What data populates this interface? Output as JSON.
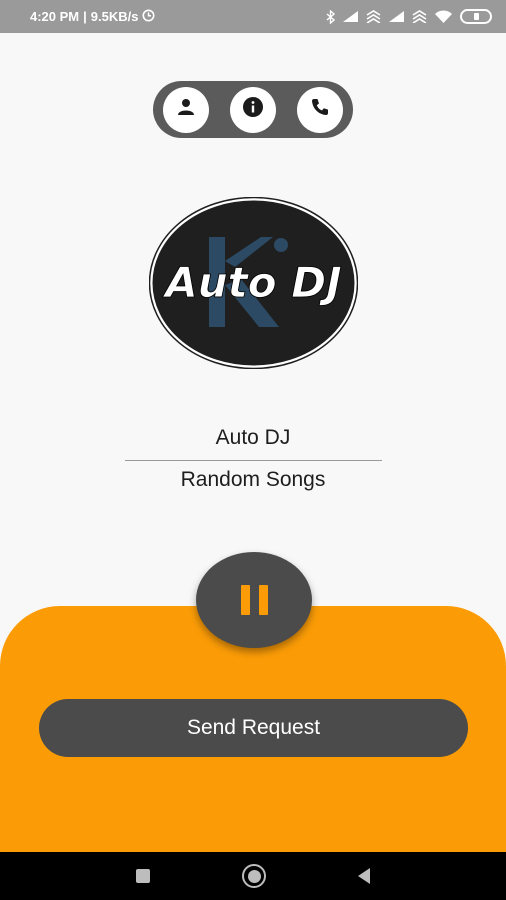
{
  "status_bar": {
    "time": "4:20 PM",
    "separator": "|",
    "network_speed": "9.5KB/s",
    "icons": [
      "clock-icon",
      "bluetooth-icon",
      "signal-icon",
      "data-icon",
      "signal-icon",
      "data-icon",
      "wifi-icon",
      "battery-icon"
    ]
  },
  "top_buttons": {
    "icons": [
      "person-icon",
      "info-icon",
      "phone-icon"
    ]
  },
  "logo": {
    "text": "Auto DJ"
  },
  "station": {
    "title": "Auto DJ",
    "subtitle": "Random Songs"
  },
  "player": {
    "state_icon": "pause-icon"
  },
  "send_button": {
    "label": "Send Request"
  },
  "colors": {
    "accent": "#fb9c07",
    "dark_button": "#4b4b4b",
    "pill": "#5b5b5b",
    "background": "#f8f8f8",
    "status_bar": "#9a9a9a"
  },
  "nav_bar": {
    "icons": [
      "recent-apps-icon",
      "home-icon",
      "back-icon"
    ]
  }
}
